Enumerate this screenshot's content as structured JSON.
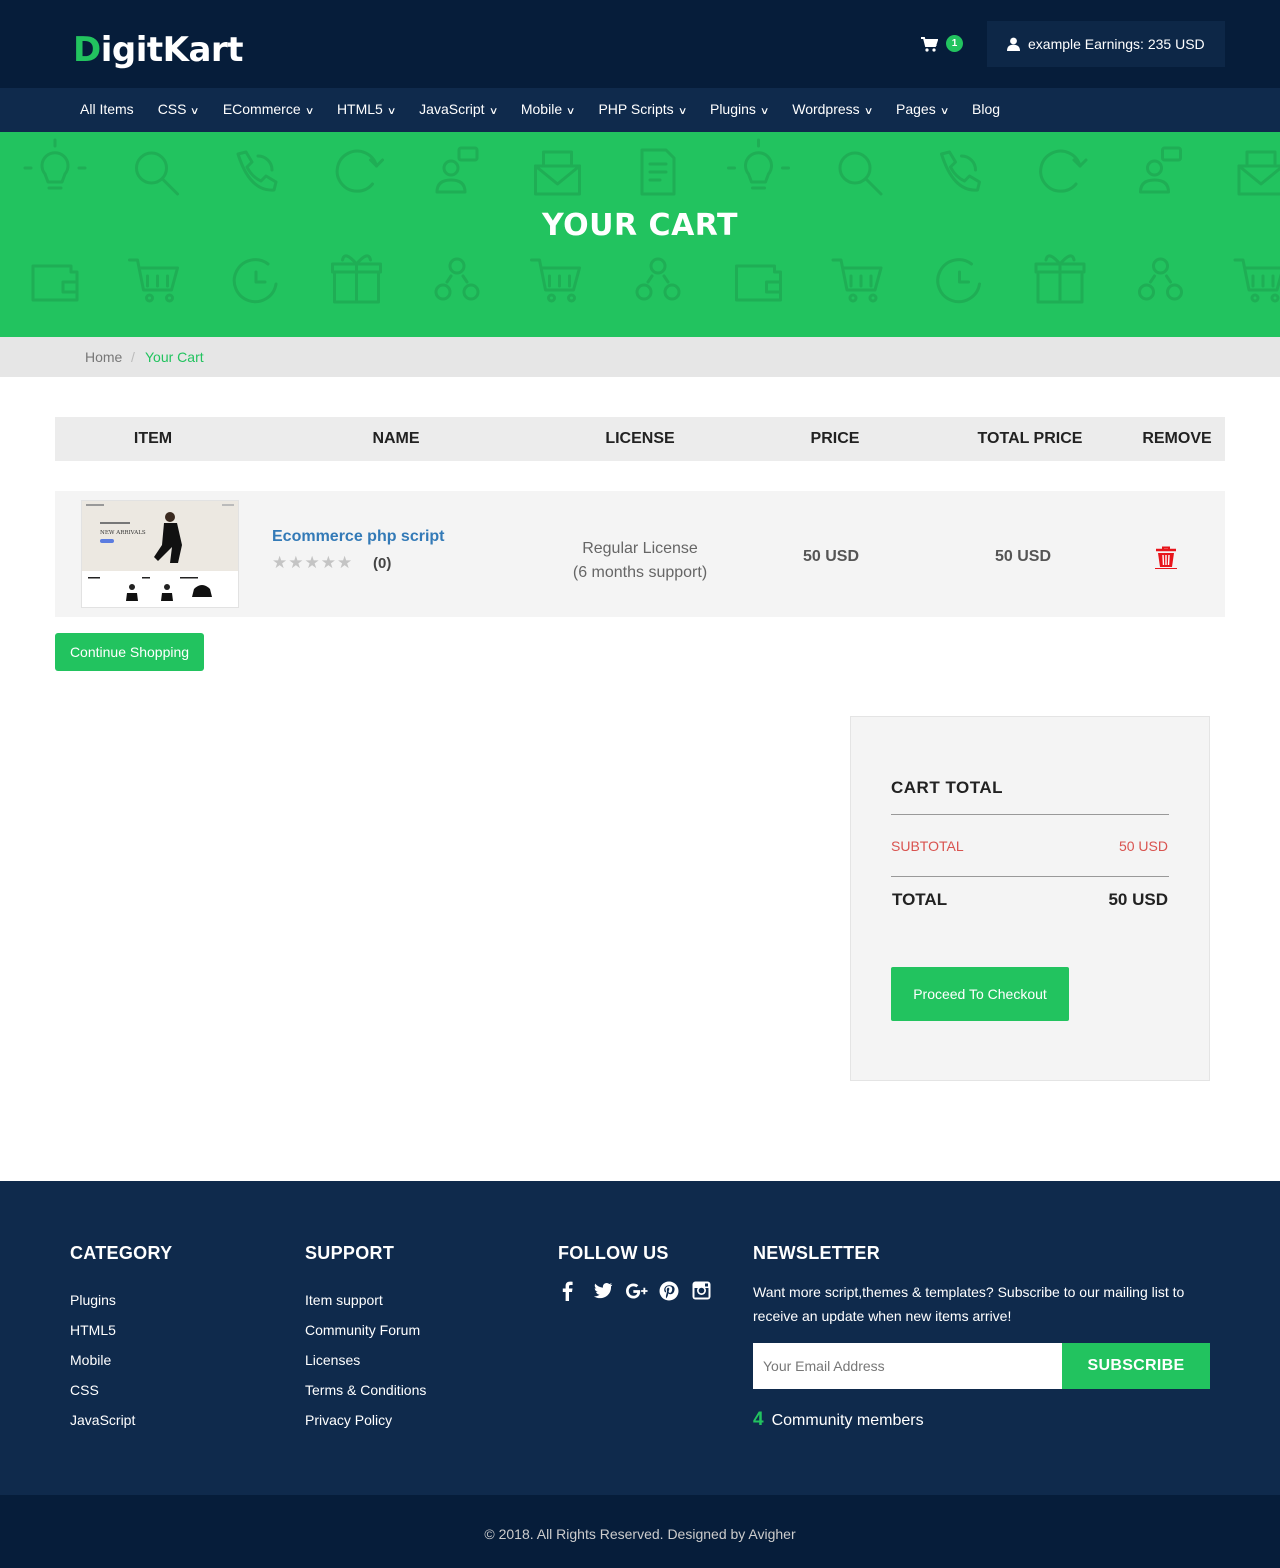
{
  "header": {
    "logo_first": "D",
    "logo_rest": "igitKart",
    "cart_count": "1",
    "account_label": "example Earnings: 235 USD"
  },
  "nav": [
    {
      "label": "All Items",
      "has_dropdown": false
    },
    {
      "label": "CSS",
      "has_dropdown": true
    },
    {
      "label": "ECommerce",
      "has_dropdown": true
    },
    {
      "label": "HTML5",
      "has_dropdown": true
    },
    {
      "label": "JavaScript",
      "has_dropdown": true
    },
    {
      "label": "Mobile",
      "has_dropdown": true
    },
    {
      "label": "PHP Scripts",
      "has_dropdown": true
    },
    {
      "label": "Plugins",
      "has_dropdown": true
    },
    {
      "label": "Wordpress",
      "has_dropdown": true
    },
    {
      "label": "Pages",
      "has_dropdown": true
    },
    {
      "label": "Blog",
      "has_dropdown": false
    }
  ],
  "hero": {
    "title": "YOUR CART"
  },
  "breadcrumb": {
    "home": "Home",
    "separator": "/",
    "current": "Your Cart"
  },
  "table": {
    "headers": {
      "item": "ITEM",
      "name": "NAME",
      "license": "LICENSE",
      "price": "PRICE",
      "total": "TOTAL PRICE",
      "remove": "REMOVE"
    },
    "rows": [
      {
        "thumb_headline": "NEW ARRIVALS",
        "name": "Ecommerce php script",
        "stars": "★★★★★",
        "rating": 0,
        "rating_count": "(0)",
        "license_line1": "Regular License",
        "license_line2": "(6 months support)",
        "price": "50 USD",
        "total_price": "50 USD"
      }
    ]
  },
  "continue_label": "Continue Shopping",
  "totals": {
    "title": "CART TOTAL",
    "subtotal_label": "SUBTOTAL",
    "subtotal_value": "50 USD",
    "total_label": "TOTAL",
    "total_value": "50 USD",
    "checkout_label": "Proceed To Checkout"
  },
  "footer": {
    "category": {
      "title": "CATEGORY",
      "links": [
        "Plugins",
        "HTML5",
        "Mobile",
        "CSS",
        "JavaScript"
      ]
    },
    "support": {
      "title": "SUPPORT",
      "links": [
        "Item support",
        "Community Forum",
        "Licenses",
        "Terms & Conditions",
        "Privacy Policy"
      ]
    },
    "follow": {
      "title": "FOLLOW US",
      "icons": [
        "facebook-icon",
        "twitter-icon",
        "google-plus-icon",
        "pinterest-icon",
        "instagram-icon"
      ]
    },
    "newsletter": {
      "title": "NEWSLETTER",
      "text": "Want more script,themes & templates? Subscribe to our mailing list to receive an update when new items arrive!",
      "placeholder": "Your Email Address",
      "subscribe_label": "SUBSCRIBE",
      "community_count": "4",
      "community_label": "Community members"
    },
    "copyright": "© 2018. All Rights Reserved. Designed by Avigher"
  },
  "colors": {
    "brand_green": "#22c35f",
    "header_dark": "#061d3a",
    "nav_blue": "#0f2a4c",
    "link_blue": "#337ab7",
    "subtotal_red": "#d9534f"
  }
}
